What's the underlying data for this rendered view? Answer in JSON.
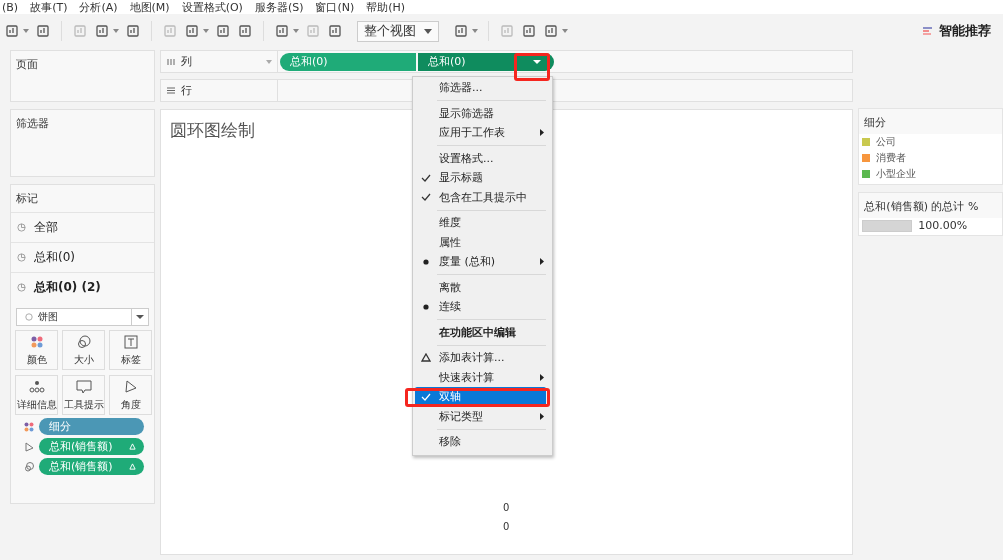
{
  "menubar": [
    "(B)",
    "故事(T)",
    "分析(A)",
    "地图(M)",
    "设置格式(O)",
    "服务器(S)",
    "窗口(N)",
    "帮助(H)"
  ],
  "toolbar": {
    "view_select": "整个视图",
    "show_me": "智能推荐"
  },
  "left_panels": {
    "pages": "页面",
    "filters": "筛选器"
  },
  "marks": {
    "title": "标记",
    "layers": [
      {
        "label": "全部",
        "selected": false
      },
      {
        "label": "总和(0)",
        "selected": false
      },
      {
        "label": "总和(0) (2)",
        "selected": true
      }
    ],
    "mark_type": "饼图",
    "properties": [
      "颜色",
      "大小",
      "标签",
      "详细信息",
      "工具提示",
      "角度"
    ],
    "pills": [
      {
        "label": "细分",
        "kind": "color",
        "delta": false
      },
      {
        "label": "总和(销售额)",
        "kind": "angle",
        "delta": true
      },
      {
        "label": "总和(销售额)",
        "kind": "size",
        "delta": true
      }
    ]
  },
  "shelves": {
    "columns_label": "列",
    "rows_label": "行",
    "column_pills": [
      {
        "label": "总和(0)",
        "selected": false
      },
      {
        "label": "总和(0)",
        "selected": true
      }
    ]
  },
  "canvas": {
    "title": "圆环图绘制",
    "axis_labels": [
      "0",
      "0"
    ]
  },
  "context_menu": [
    {
      "kind": "plain",
      "label": "筛选器...",
      "submenu": false,
      "bold": false,
      "selected": false
    },
    {
      "kind": "separator"
    },
    {
      "kind": "plain",
      "label": "显示筛选器",
      "submenu": false,
      "bold": false,
      "selected": false
    },
    {
      "kind": "plain",
      "label": "应用于工作表",
      "submenu": true,
      "bold": false,
      "selected": false
    },
    {
      "kind": "separator"
    },
    {
      "kind": "plain",
      "label": "设置格式...",
      "submenu": false,
      "bold": false,
      "selected": false
    },
    {
      "kind": "check",
      "label": "显示标题",
      "submenu": false,
      "bold": false,
      "selected": false
    },
    {
      "kind": "check",
      "label": "包含在工具提示中",
      "submenu": false,
      "bold": false,
      "selected": false
    },
    {
      "kind": "separator"
    },
    {
      "kind": "plain",
      "label": "维度",
      "submenu": false,
      "bold": false,
      "selected": false
    },
    {
      "kind": "plain",
      "label": "属性",
      "submenu": false,
      "bold": false,
      "selected": false
    },
    {
      "kind": "bullet",
      "label": "度量 (总和)",
      "submenu": true,
      "bold": false,
      "selected": false
    },
    {
      "kind": "separator"
    },
    {
      "kind": "plain",
      "label": "离散",
      "submenu": false,
      "bold": false,
      "selected": false
    },
    {
      "kind": "bullet",
      "label": "连续",
      "submenu": false,
      "bold": false,
      "selected": false
    },
    {
      "kind": "separator"
    },
    {
      "kind": "plain",
      "label": "在功能区中编辑",
      "submenu": false,
      "bold": true,
      "selected": false
    },
    {
      "kind": "separator"
    },
    {
      "kind": "delta",
      "label": "添加表计算...",
      "submenu": false,
      "bold": false,
      "selected": false
    },
    {
      "kind": "plain",
      "label": "快速表计算",
      "submenu": true,
      "bold": false,
      "selected": false
    },
    {
      "kind": "check",
      "label": "双轴",
      "submenu": false,
      "bold": false,
      "selected": true
    },
    {
      "kind": "plain",
      "label": "标记类型",
      "submenu": true,
      "bold": false,
      "selected": false
    },
    {
      "kind": "separator"
    },
    {
      "kind": "plain",
      "label": "移除",
      "submenu": false,
      "bold": false,
      "selected": false
    }
  ],
  "legend": {
    "title": "细分",
    "items": [
      {
        "label": "公司",
        "color": "#c9c94f"
      },
      {
        "label": "消费者",
        "color": "#f7963e"
      },
      {
        "label": "小型企业",
        "color": "#5bb84f"
      }
    ]
  },
  "percent_legend": {
    "title": "总和(销售额) 的总计 %",
    "value": "100.00%"
  }
}
